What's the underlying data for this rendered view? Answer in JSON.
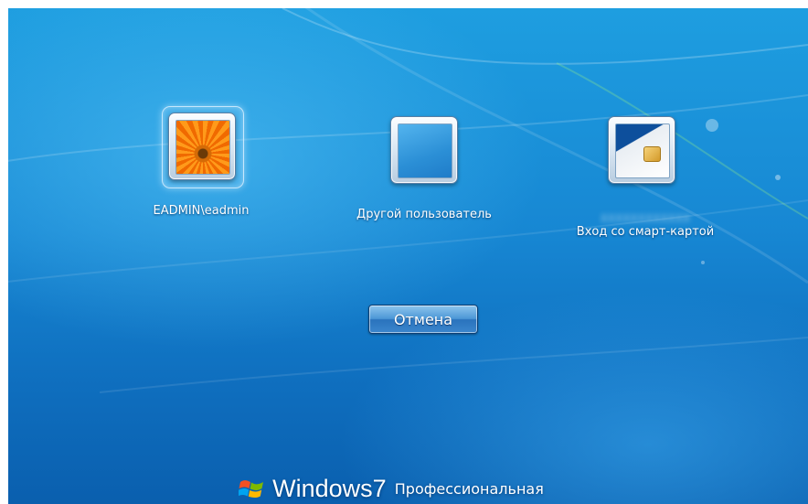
{
  "tiles": [
    {
      "label": "EADMIN\\eadmin",
      "type": "user-account",
      "selected": true,
      "picture": "orange-flower"
    },
    {
      "label": "Другой пользователь",
      "type": "other-user",
      "selected": false,
      "picture": "blank"
    },
    {
      "label": "Вход со смарт-картой",
      "type": "smart-card",
      "selected": false,
      "picture": "smart-card",
      "blurred_line": "XXXXXXXXXXXX"
    }
  ],
  "cancel_button": {
    "label": "Отмена"
  },
  "branding": {
    "wordmark": "Windows",
    "version": "7",
    "edition": "Профессиональная",
    "logo_icon": "windows-flag-icon"
  },
  "colors": {
    "background_top": "#1e9ee0",
    "background_bottom": "#0a5fae",
    "text": "#ffffff",
    "button_face": "#4c97d6"
  }
}
